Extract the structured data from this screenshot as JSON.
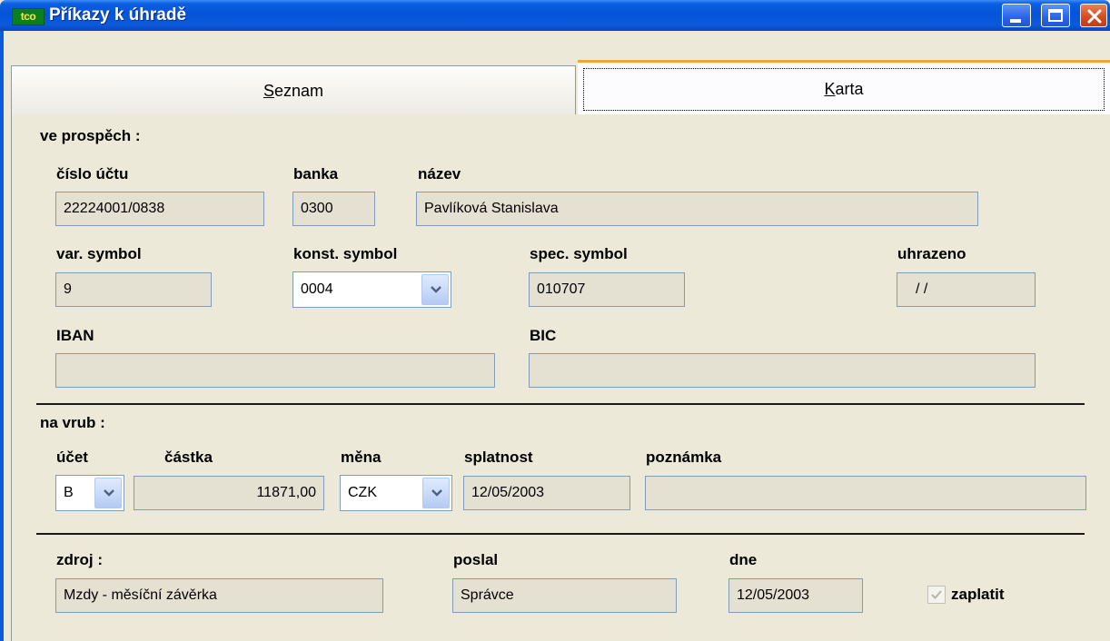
{
  "window": {
    "title": "Příkazy k úhradě",
    "app_icon_text": "tco"
  },
  "tabs": {
    "seznam": "Seznam",
    "karta": "Karta",
    "active": "Karta"
  },
  "ve_prospech": {
    "heading": "ve prospěch :",
    "cislo_uctu": {
      "label": "číslo účtu",
      "value": "22224001/0838"
    },
    "banka": {
      "label": "banka",
      "value": "0300"
    },
    "nazev": {
      "label": "název",
      "value": "Pavlíková Stanislava"
    },
    "var_symbol": {
      "label": "var. symbol",
      "value": "9"
    },
    "konst_symbol": {
      "label": "konst. symbol",
      "value": "0004"
    },
    "spec_symbol": {
      "label": "spec. symbol",
      "value": "010707"
    },
    "uhrazeno": {
      "label": "uhrazeno",
      "value": " / /"
    },
    "iban": {
      "label": "IBAN",
      "value": ""
    },
    "bic": {
      "label": "BIC",
      "value": ""
    }
  },
  "na_vrub": {
    "heading": "na vrub :",
    "ucet": {
      "label": "účet",
      "value": "B"
    },
    "castka": {
      "label": "částka",
      "value": "11871,00"
    },
    "mena": {
      "label": "měna",
      "value": "CZK"
    },
    "splatnost": {
      "label": "splatnost",
      "value": "12/05/2003"
    },
    "poznamka": {
      "label": "poznámka",
      "value": ""
    }
  },
  "footer": {
    "zdroj": {
      "label": "zdroj :",
      "value": "Mzdy - měsíční závěrka"
    },
    "poslal": {
      "label": "poslal",
      "value": "Správce"
    },
    "dne": {
      "label": "dne",
      "value": "12/05/2003"
    },
    "zaplatit": {
      "label": "zaplatit",
      "checked": true
    }
  }
}
